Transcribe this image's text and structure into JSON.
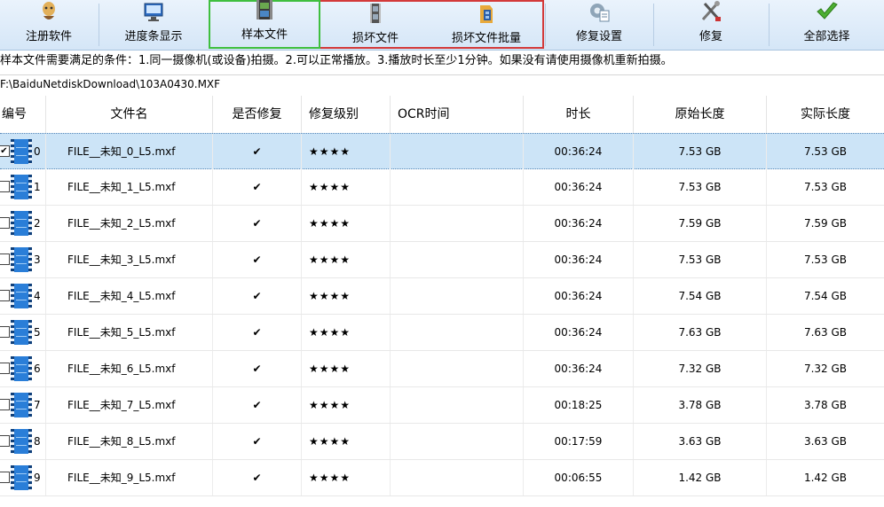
{
  "toolbar": {
    "buttons": [
      {
        "label": "注册软件",
        "icon": "register-icon"
      },
      {
        "label": "进度条显示",
        "icon": "monitor-icon"
      },
      {
        "label": "样本文件",
        "icon": "film-icon"
      },
      {
        "label": "损坏文件",
        "icon": "damaged-file-icon"
      },
      {
        "label": "损坏文件批量",
        "icon": "batch-file-icon"
      },
      {
        "label": "修复设置",
        "icon": "settings-icon"
      },
      {
        "label": "修复",
        "icon": "tools-icon"
      },
      {
        "label": "全部选择",
        "icon": "check-icon"
      }
    ]
  },
  "info_text": "样本文件需要满足的条件：1.同一摄像机(或设备)拍摄。2.可以正常播放。3.播放时长至少1分钟。如果没有请使用摄像机重新拍摄。",
  "path_text": "F:\\BaiduNetdiskDownload\\103A0430.MXF",
  "table": {
    "headers": [
      "编号",
      "文件名",
      "是否修复",
      "修复级别",
      "OCR时间",
      "时长",
      "原始长度",
      "实际长度"
    ],
    "rows": [
      {
        "id": "0",
        "name": "FILE__未知_0_L5.mxf",
        "repair": "✔",
        "level": "★★★★",
        "ocr": "",
        "duration": "00:36:24",
        "orig": "7.53 GB",
        "actual": "7.53 GB",
        "checked": "✔"
      },
      {
        "id": "1",
        "name": "FILE__未知_1_L5.mxf",
        "repair": "✔",
        "level": "★★★★",
        "ocr": "",
        "duration": "00:36:24",
        "orig": "7.53 GB",
        "actual": "7.53 GB",
        "checked": ""
      },
      {
        "id": "2",
        "name": "FILE__未知_2_L5.mxf",
        "repair": "✔",
        "level": "★★★★",
        "ocr": "",
        "duration": "00:36:24",
        "orig": "7.59 GB",
        "actual": "7.59 GB",
        "checked": ""
      },
      {
        "id": "3",
        "name": "FILE__未知_3_L5.mxf",
        "repair": "✔",
        "level": "★★★★",
        "ocr": "",
        "duration": "00:36:24",
        "orig": "7.53 GB",
        "actual": "7.53 GB",
        "checked": ""
      },
      {
        "id": "4",
        "name": "FILE__未知_4_L5.mxf",
        "repair": "✔",
        "level": "★★★★",
        "ocr": "",
        "duration": "00:36:24",
        "orig": "7.54 GB",
        "actual": "7.54 GB",
        "checked": ""
      },
      {
        "id": "5",
        "name": "FILE__未知_5_L5.mxf",
        "repair": "✔",
        "level": "★★★★",
        "ocr": "",
        "duration": "00:36:24",
        "orig": "7.63 GB",
        "actual": "7.63 GB",
        "checked": ""
      },
      {
        "id": "6",
        "name": "FILE__未知_6_L5.mxf",
        "repair": "✔",
        "level": "★★★★",
        "ocr": "",
        "duration": "00:36:24",
        "orig": "7.32 GB",
        "actual": "7.32 GB",
        "checked": ""
      },
      {
        "id": "7",
        "name": "FILE__未知_7_L5.mxf",
        "repair": "✔",
        "level": "★★★★",
        "ocr": "",
        "duration": "00:18:25",
        "orig": "3.78 GB",
        "actual": "3.78 GB",
        "checked": ""
      },
      {
        "id": "8",
        "name": "FILE__未知_8_L5.mxf",
        "repair": "✔",
        "level": "★★★★",
        "ocr": "",
        "duration": "00:17:59",
        "orig": "3.63 GB",
        "actual": "3.63 GB",
        "checked": ""
      },
      {
        "id": "9",
        "name": "FILE__未知_9_L5.mxf",
        "repair": "✔",
        "level": "★★★★",
        "ocr": "",
        "duration": "00:06:55",
        "orig": "1.42 GB",
        "actual": "1.42 GB",
        "checked": ""
      }
    ]
  },
  "colors": {
    "toolbar_bg": "#d5e6f7",
    "selected_row": "#cce4f7",
    "green_highlight": "#3fbf3f",
    "red_highlight": "#d33a3a"
  }
}
